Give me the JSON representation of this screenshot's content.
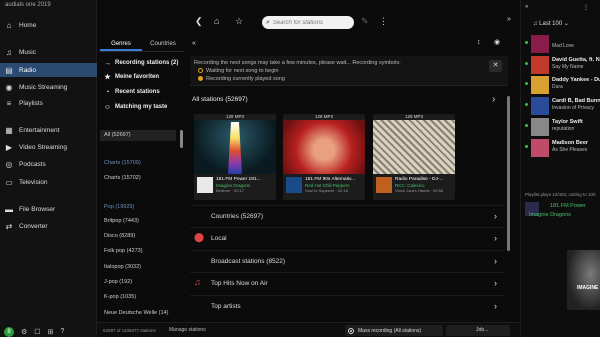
{
  "app": {
    "title": "audials one 2019"
  },
  "nav": {
    "items": [
      {
        "label": "Home",
        "icon": "home-icon",
        "glyph": "⌂"
      },
      {
        "label": "Music",
        "icon": "music-note-icon",
        "glyph": "♫"
      },
      {
        "label": "Radio",
        "icon": "radio-icon",
        "glyph": "▤"
      },
      {
        "label": "Music Streaming",
        "icon": "streaming-icon",
        "glyph": "◉"
      },
      {
        "label": "Playlists",
        "icon": "playlist-icon",
        "glyph": "≡"
      },
      {
        "label": "Entertainment",
        "icon": "entertainment-icon",
        "glyph": "▦"
      },
      {
        "label": "Video Streaming",
        "icon": "video-icon",
        "glyph": "▶"
      },
      {
        "label": "Podcasts",
        "icon": "podcast-icon",
        "glyph": "◎"
      },
      {
        "label": "Television",
        "icon": "tv-icon",
        "glyph": "▭"
      },
      {
        "label": "File Browser",
        "icon": "folder-icon",
        "glyph": "▬"
      },
      {
        "label": "Converter",
        "icon": "converter-icon",
        "glyph": "⇄"
      }
    ],
    "bottom": [
      "8",
      "⚙",
      "☐",
      "⊞",
      "?"
    ]
  },
  "search": {
    "placeholder": "Search for stations"
  },
  "tabs": [
    "Genres",
    "Countries"
  ],
  "quicklinks": [
    {
      "label": "Recording stations (2)",
      "glyph": "→"
    },
    {
      "label": "Meine favoriten",
      "glyph": "★"
    },
    {
      "label": "Recent stations",
      "glyph": "◔"
    },
    {
      "label": "Matching my taste",
      "glyph": "☺"
    }
  ],
  "genres": [
    {
      "label": "All (52697)",
      "kind": "sel"
    },
    {
      "label": "Charts (15709)",
      "kind": "hdr"
    },
    {
      "label": "Charts (15702)",
      "kind": ""
    },
    {
      "label": "Pop (19929)",
      "kind": "hdr"
    },
    {
      "label": "Britpop (7443)",
      "kind": ""
    },
    {
      "label": "Disco (8289)",
      "kind": ""
    },
    {
      "label": "Folk pop (4273)",
      "kind": ""
    },
    {
      "label": "Italopop (3032)",
      "kind": ""
    },
    {
      "label": "J-pop (192)",
      "kind": ""
    },
    {
      "label": "K-pop (1035)",
      "kind": ""
    },
    {
      "label": "Neue Deutsche Welle (14)",
      "kind": ""
    }
  ],
  "notice": {
    "line1": "Recording the next songs may take a few minutes, please wait... Recording symbols:",
    "line2": "Waiting for next song to begin",
    "line3": "Recording currently played song"
  },
  "main": {
    "all_stations": "All stations (52697)",
    "cards": [
      {
        "kbps": "128 MP3",
        "name": "181.FM Power 181...",
        "sub": "Imagine Dragons",
        "sub2": "Believer · 00:17"
      },
      {
        "kbps": "128 MP3",
        "name": "181.FM 90s Alternativ...",
        "sub": "Red Hot Chili Peppers",
        "sub2": "Soul to Squeeze · 02:18"
      },
      {
        "kbps": "128 MP3",
        "name": "Radio Paradise - DJ-...",
        "sub": "RCC: Calexico",
        "sub2": "Victor Jara's Hands · 00:56"
      }
    ],
    "rows": [
      {
        "label": "Countries (52697)",
        "glyph": ""
      },
      {
        "label": "Local",
        "glyph": "⬤"
      },
      {
        "label": "Broadcast stations (8522)",
        "glyph": ""
      },
      {
        "label": "Top Hits Now on Air",
        "glyph": "♫"
      },
      {
        "label": "Top artists",
        "glyph": ""
      }
    ]
  },
  "bottombar": {
    "left": "52697 of 1106077 stations",
    "manage": "Manage stations",
    "mass": "Mass recording (All stations)",
    "jobs": "Job..."
  },
  "right": {
    "header": "Last 100",
    "songs": [
      {
        "title": "",
        "artist": "Mad Love",
        "color": "#8a1c4a"
      },
      {
        "title": "David Guetta, ft. Nic...",
        "artist": "Say My Name",
        "color": "#c23a2a"
      },
      {
        "title": "Daddy Yankee - Dura",
        "artist": "Dura",
        "color": "#d8a030"
      },
      {
        "title": "Cardi B, Bad Bunny...",
        "artist": "Invasion of Privacy",
        "color": "#2a4a9a"
      },
      {
        "title": "Taylor Swift",
        "artist": "reputation",
        "color": "#888888"
      },
      {
        "title": "Madison Beer",
        "artist": "As She Pleases",
        "color": "#c04a6a"
      }
    ],
    "footer": "Playlist plays 12/403, cutting to 100",
    "now_title": "181.FM Power",
    "now_artist": "Imagine Dragons",
    "art_label": "IMAGINE"
  }
}
